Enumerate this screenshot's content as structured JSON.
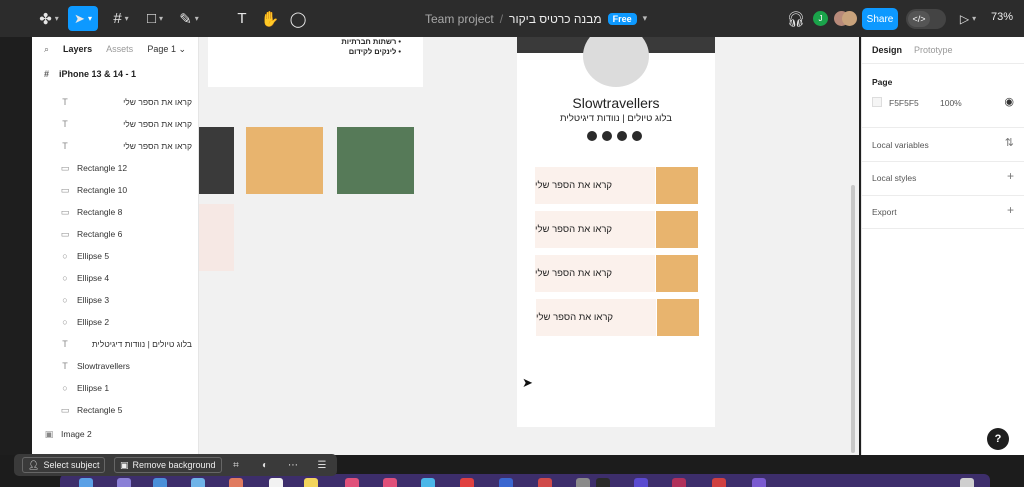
{
  "toolbar": {
    "team": "Team project",
    "separator": "/",
    "file_name": "מבנה כרטיס ביקור",
    "badge": "Free",
    "share": "Share",
    "dev_mode": "</>",
    "zoom": "73%",
    "avatar_initial": "J"
  },
  "left_panel": {
    "tab_layers": "Layers",
    "tab_assets": "Assets",
    "page": "Page 1 ⌄",
    "frame": "iPhone 13 & 14 - 1",
    "layers": [
      {
        "name": "קראו את הספר שלי",
        "icon": "T"
      },
      {
        "name": "קראו את הספר שלי",
        "icon": "T"
      },
      {
        "name": "קראו את הספר שלי",
        "icon": "T"
      },
      {
        "name": "Rectangle 12",
        "icon": "▭"
      },
      {
        "name": "Rectangle 10",
        "icon": "▭"
      },
      {
        "name": "Rectangle 8",
        "icon": "▭"
      },
      {
        "name": "Rectangle 6",
        "icon": "▭"
      },
      {
        "name": "Ellipse 5",
        "icon": "○"
      },
      {
        "name": "Ellipse 4",
        "icon": "○"
      },
      {
        "name": "Ellipse 3",
        "icon": "○"
      },
      {
        "name": "Ellipse 2",
        "icon": "○"
      },
      {
        "name": "בלוג טיולים | נוודות דיגיטלית",
        "icon": "T"
      },
      {
        "name": "Slowtravellers",
        "icon": "T"
      },
      {
        "name": "Ellipse 1",
        "icon": "○"
      },
      {
        "name": "Rectangle 5",
        "icon": "▭"
      }
    ],
    "image_layer": "Image 2"
  },
  "canvas": {
    "card_lines": [
      "רשתות חברתיות",
      "לינקים לקידום"
    ],
    "phone": {
      "title": "Slowtravellers",
      "subtitle": "בלוג טיולים | נוודות דיגיטלית",
      "buttons": [
        "קראו את הספר שלי",
        "קראו את הספר שלי",
        "קראו את הספר שלי",
        "קראו את הספר שלי"
      ]
    }
  },
  "right_panel": {
    "tab_design": "Design",
    "tab_prototype": "Prototype",
    "page_label": "Page",
    "page_color": "F5F5F5",
    "page_opacity": "100%",
    "local_variables": "Local variables",
    "local_styles": "Local styles",
    "export": "Export"
  },
  "context_bar": {
    "select_subject": "Select subject",
    "remove_background": "Remove background"
  },
  "help": "?",
  "colors": {
    "accent": "#0d99ff",
    "swatch_dark": "#3a3a3a",
    "swatch_orange": "#e8b46e",
    "swatch_green": "#567a58",
    "swatch_pink": "#f6e8e4"
  }
}
